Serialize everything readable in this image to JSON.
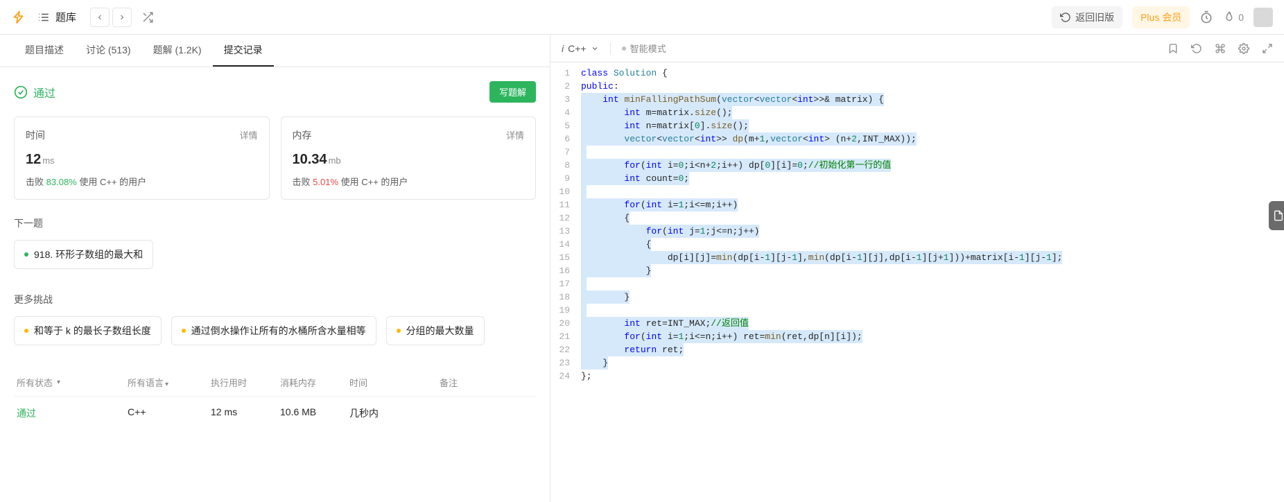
{
  "header": {
    "problems_label": "题库",
    "old_version": "返回旧版",
    "plus": "Plus 会员",
    "fire_count": "0"
  },
  "tabs": [
    {
      "label": "题目描述"
    },
    {
      "label": "讨论 (513)"
    },
    {
      "label": "题解 (1.2K)"
    },
    {
      "label": "提交记录"
    }
  ],
  "active_tab": 3,
  "result": {
    "status": "通过",
    "write_solution": "写题解"
  },
  "stats": {
    "time": {
      "label": "时间",
      "detail": "详情",
      "value": "12",
      "unit": "ms",
      "beat_prefix": "击败",
      "beat_pct": "83.08%",
      "beat_suffix": "使用 C++ 的用户"
    },
    "memory": {
      "label": "内存",
      "detail": "详情",
      "value": "10.34",
      "unit": "mb",
      "beat_prefix": "击败",
      "beat_pct": "5.01%",
      "beat_suffix": "使用 C++ 的用户"
    }
  },
  "next_section": {
    "title": "下一题",
    "item": "918. 环形子数组的最大和"
  },
  "more_section": {
    "title": "更多挑战",
    "items": [
      "和等于 k 的最长子数组长度",
      "通过倒水操作让所有的水桶所含水量相等",
      "分组的最大数量"
    ]
  },
  "table": {
    "cols": {
      "status": "所有状态",
      "lang": "所有语言",
      "time": "执行用时",
      "mem": "消耗内存",
      "when": "时间",
      "note": "备注"
    },
    "row": {
      "status": "通过",
      "lang": "C++",
      "time": "12 ms",
      "mem": "10.6 MB",
      "when": "几秒内"
    }
  },
  "code_header": {
    "lang_prefix": "i",
    "lang": "C++",
    "smart_mode": "智能模式"
  },
  "code": {
    "lines": [
      {
        "n": 1,
        "hl": false,
        "segs": [
          {
            "t": "class ",
            "c": "kw"
          },
          {
            "t": "Solution",
            "c": "type"
          },
          {
            "t": " {",
            "c": ""
          }
        ]
      },
      {
        "n": 2,
        "hl": false,
        "segs": [
          {
            "t": "public",
            "c": "kw"
          },
          {
            "t": ":",
            "c": ""
          }
        ]
      },
      {
        "n": 3,
        "hl": true,
        "pre": "    ",
        "segs": [
          {
            "t": "int ",
            "c": "kw"
          },
          {
            "t": "minFallingPathSum",
            "c": "fn"
          },
          {
            "t": "(",
            "c": ""
          },
          {
            "t": "vector",
            "c": "type"
          },
          {
            "t": "<",
            "c": ""
          },
          {
            "t": "vector",
            "c": "type"
          },
          {
            "t": "<",
            "c": ""
          },
          {
            "t": "int",
            "c": "kw"
          },
          {
            "t": ">>& matrix) {",
            "c": ""
          }
        ]
      },
      {
        "n": 4,
        "hl": true,
        "pre": "        ",
        "segs": [
          {
            "t": "int",
            "c": "kw"
          },
          {
            "t": " m=matrix.",
            "c": ""
          },
          {
            "t": "size",
            "c": "fn"
          },
          {
            "t": "();",
            "c": ""
          }
        ]
      },
      {
        "n": 5,
        "hl": true,
        "pre": "        ",
        "segs": [
          {
            "t": "int",
            "c": "kw"
          },
          {
            "t": " n=matrix[",
            "c": ""
          },
          {
            "t": "0",
            "c": "num"
          },
          {
            "t": "].",
            "c": ""
          },
          {
            "t": "size",
            "c": "fn"
          },
          {
            "t": "();",
            "c": ""
          }
        ]
      },
      {
        "n": 6,
        "hl": true,
        "pre": "        ",
        "segs": [
          {
            "t": "vector",
            "c": "type"
          },
          {
            "t": "<",
            "c": ""
          },
          {
            "t": "vector",
            "c": "type"
          },
          {
            "t": "<",
            "c": ""
          },
          {
            "t": "int",
            "c": "kw"
          },
          {
            "t": ">> ",
            "c": ""
          },
          {
            "t": "dp",
            "c": "fn"
          },
          {
            "t": "(m+",
            "c": ""
          },
          {
            "t": "1",
            "c": "num"
          },
          {
            "t": ",",
            "c": ""
          },
          {
            "t": "vector",
            "c": "type"
          },
          {
            "t": "<",
            "c": ""
          },
          {
            "t": "int",
            "c": "kw"
          },
          {
            "t": "> (n+",
            "c": ""
          },
          {
            "t": "2",
            "c": "num"
          },
          {
            "t": ",INT_MAX));",
            "c": ""
          }
        ]
      },
      {
        "n": 7,
        "hl": true,
        "pre": "",
        "segs": [
          {
            "t": " ",
            "c": ""
          }
        ]
      },
      {
        "n": 8,
        "hl": true,
        "pre": "        ",
        "segs": [
          {
            "t": "for",
            "c": "kw"
          },
          {
            "t": "(",
            "c": ""
          },
          {
            "t": "int",
            "c": "kw"
          },
          {
            "t": " i=",
            "c": ""
          },
          {
            "t": "0",
            "c": "num"
          },
          {
            "t": ";i<n+",
            "c": ""
          },
          {
            "t": "2",
            "c": "num"
          },
          {
            "t": ";i++) dp[",
            "c": ""
          },
          {
            "t": "0",
            "c": "num"
          },
          {
            "t": "][i]=",
            "c": ""
          },
          {
            "t": "0",
            "c": "num"
          },
          {
            "t": ";",
            "c": ""
          },
          {
            "t": "//初始化第一行的值",
            "c": "cmt"
          }
        ]
      },
      {
        "n": 9,
        "hl": true,
        "pre": "        ",
        "segs": [
          {
            "t": "int",
            "c": "kw"
          },
          {
            "t": " count=",
            "c": ""
          },
          {
            "t": "0",
            "c": "num"
          },
          {
            "t": ";",
            "c": ""
          }
        ]
      },
      {
        "n": 10,
        "hl": true,
        "pre": "",
        "segs": [
          {
            "t": " ",
            "c": ""
          }
        ]
      },
      {
        "n": 11,
        "hl": true,
        "pre": "        ",
        "segs": [
          {
            "t": "for",
            "c": "kw"
          },
          {
            "t": "(",
            "c": ""
          },
          {
            "t": "int",
            "c": "kw"
          },
          {
            "t": " i=",
            "c": ""
          },
          {
            "t": "1",
            "c": "num"
          },
          {
            "t": ";i<=m;i++)",
            "c": ""
          }
        ]
      },
      {
        "n": 12,
        "hl": true,
        "pre": "        ",
        "segs": [
          {
            "t": "{",
            "c": ""
          }
        ]
      },
      {
        "n": 13,
        "hl": true,
        "pre": "            ",
        "segs": [
          {
            "t": "for",
            "c": "kw"
          },
          {
            "t": "(",
            "c": ""
          },
          {
            "t": "int",
            "c": "kw"
          },
          {
            "t": " j=",
            "c": ""
          },
          {
            "t": "1",
            "c": "num"
          },
          {
            "t": ";j<=n;j++)",
            "c": ""
          }
        ]
      },
      {
        "n": 14,
        "hl": true,
        "pre": "            ",
        "segs": [
          {
            "t": "{",
            "c": ""
          }
        ]
      },
      {
        "n": 15,
        "hl": true,
        "pre": "                ",
        "segs": [
          {
            "t": "dp[i][j]=",
            "c": ""
          },
          {
            "t": "min",
            "c": "fn"
          },
          {
            "t": "(dp[i-",
            "c": ""
          },
          {
            "t": "1",
            "c": "num"
          },
          {
            "t": "][j-",
            "c": ""
          },
          {
            "t": "1",
            "c": "num"
          },
          {
            "t": "],",
            "c": ""
          },
          {
            "t": "min",
            "c": "fn"
          },
          {
            "t": "(dp[i-",
            "c": ""
          },
          {
            "t": "1",
            "c": "num"
          },
          {
            "t": "][j],dp[i-",
            "c": ""
          },
          {
            "t": "1",
            "c": "num"
          },
          {
            "t": "][j+",
            "c": ""
          },
          {
            "t": "1",
            "c": "num"
          },
          {
            "t": "]))+matrix[i-",
            "c": ""
          },
          {
            "t": "1",
            "c": "num"
          },
          {
            "t": "][j-",
            "c": ""
          },
          {
            "t": "1",
            "c": "num"
          },
          {
            "t": "];",
            "c": ""
          }
        ]
      },
      {
        "n": 16,
        "hl": true,
        "pre": "            ",
        "segs": [
          {
            "t": "}",
            "c": ""
          }
        ]
      },
      {
        "n": 17,
        "hl": true,
        "pre": "",
        "segs": [
          {
            "t": " ",
            "c": ""
          }
        ]
      },
      {
        "n": 18,
        "hl": true,
        "pre": "        ",
        "segs": [
          {
            "t": "}",
            "c": ""
          }
        ]
      },
      {
        "n": 19,
        "hl": true,
        "pre": "",
        "segs": [
          {
            "t": " ",
            "c": ""
          }
        ]
      },
      {
        "n": 20,
        "hl": true,
        "pre": "        ",
        "segs": [
          {
            "t": "int",
            "c": "kw"
          },
          {
            "t": " ret=INT_MAX;",
            "c": ""
          },
          {
            "t": "//返回值",
            "c": "cmt"
          }
        ]
      },
      {
        "n": 21,
        "hl": true,
        "pre": "        ",
        "segs": [
          {
            "t": "for",
            "c": "kw"
          },
          {
            "t": "(",
            "c": ""
          },
          {
            "t": "int",
            "c": "kw"
          },
          {
            "t": " i=",
            "c": ""
          },
          {
            "t": "1",
            "c": "num"
          },
          {
            "t": ";i<=n;i++) ret=",
            "c": ""
          },
          {
            "t": "min",
            "c": "fn"
          },
          {
            "t": "(ret,dp[n][i]);",
            "c": ""
          }
        ]
      },
      {
        "n": 22,
        "hl": true,
        "pre": "        ",
        "segs": [
          {
            "t": "return",
            "c": "kw"
          },
          {
            "t": " ret;",
            "c": ""
          }
        ]
      },
      {
        "n": 23,
        "hl": true,
        "pre": "    ",
        "segs": [
          {
            "t": "}",
            "c": ""
          }
        ]
      },
      {
        "n": 24,
        "hl": false,
        "segs": [
          {
            "t": "};",
            "c": ""
          }
        ]
      }
    ]
  }
}
